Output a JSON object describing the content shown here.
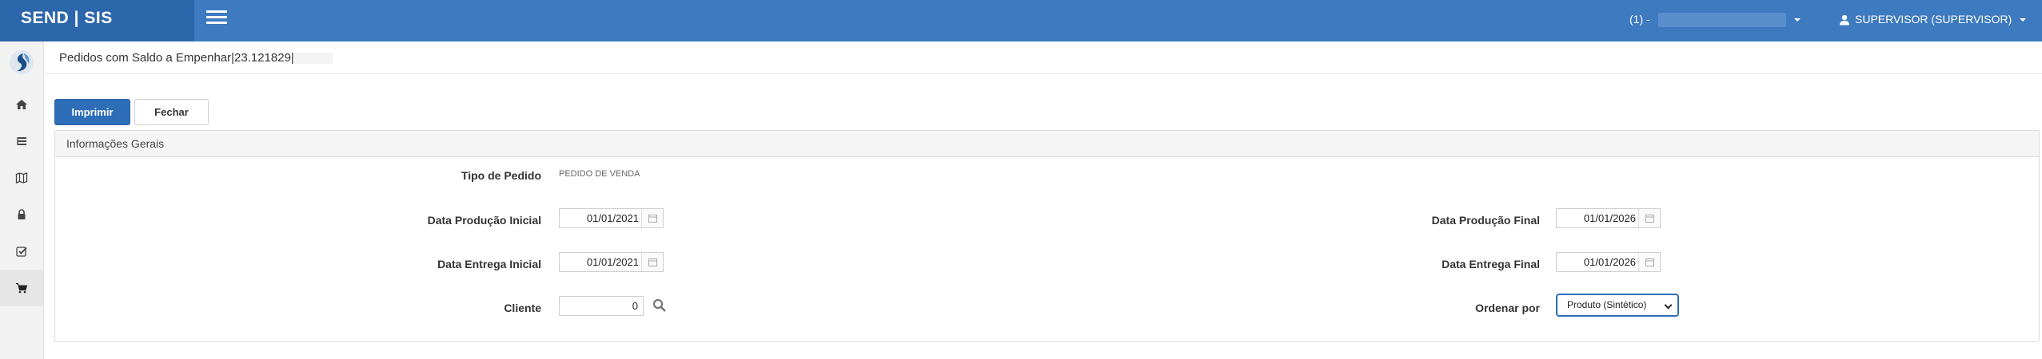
{
  "header": {
    "brand": "SEND | SIS",
    "company_prefix": "(1) -",
    "user": "SUPERVISOR (SUPERVISOR)"
  },
  "sidebar": {
    "items": [
      {
        "icon": "home-icon"
      },
      {
        "icon": "list-icon"
      },
      {
        "icon": "map-icon"
      },
      {
        "icon": "lock-icon"
      },
      {
        "icon": "check-square-icon"
      },
      {
        "icon": "cart-icon"
      }
    ]
  },
  "page": {
    "title": "Pedidos com Saldo a Empenhar|23.121829|"
  },
  "toolbar": {
    "print_label": "Imprimir",
    "close_label": "Fechar"
  },
  "panel": {
    "title": "Informações Gerais",
    "tipo_pedido_label": "Tipo de Pedido",
    "tipo_pedido_value": "PEDIDO DE VENDA",
    "data_producao_inicial_label": "Data Produção Inicial",
    "data_producao_inicial_value": "01/01/2021",
    "data_producao_final_label": "Data Produção Final",
    "data_producao_final_value": "01/01/2026",
    "data_entrega_inicial_label": "Data Entrega Inicial",
    "data_entrega_inicial_value": "01/01/2021",
    "data_entrega_final_label": "Data Entrega Final",
    "data_entrega_final_value": "01/01/2026",
    "cliente_label": "Cliente",
    "cliente_value": "0",
    "ordenar_label": "Ordenar por",
    "ordenar_value": "Produto (Sintético)"
  },
  "colors": {
    "topbar": "#3d7ac0",
    "brand_bg": "#2c66ab",
    "primary": "#2e6eb8"
  }
}
